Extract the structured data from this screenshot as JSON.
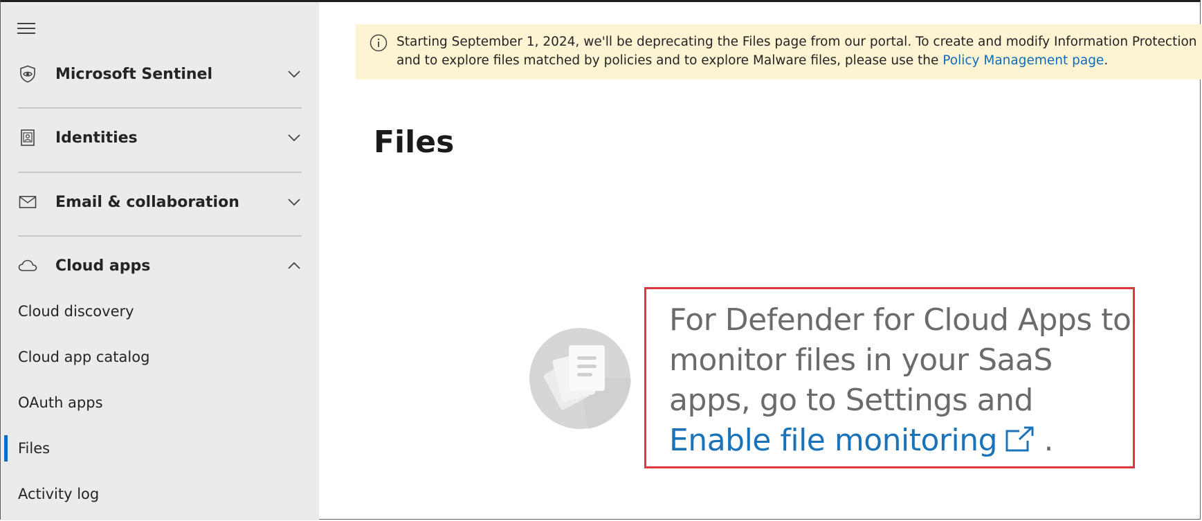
{
  "sidebar": {
    "menu_icon": "hamburger-icon",
    "groups": [
      {
        "label": "Microsoft Sentinel",
        "icon": "shield-eye-icon",
        "expanded": false
      },
      {
        "label": "Identities",
        "icon": "identity-card-icon",
        "expanded": false
      },
      {
        "label": "Email & collaboration",
        "icon": "mail-icon",
        "expanded": false
      },
      {
        "label": "Cloud apps",
        "icon": "cloud-icon",
        "expanded": true
      }
    ],
    "items": [
      {
        "label": "Cloud discovery",
        "active": false
      },
      {
        "label": "Cloud app catalog",
        "active": false
      },
      {
        "label": "OAuth apps",
        "active": false
      },
      {
        "label": "Files",
        "active": true
      },
      {
        "label": "Activity log",
        "active": false
      }
    ]
  },
  "banner": {
    "icon": "info-icon",
    "line1": "Starting September 1, 2024, we'll be deprecating the Files page from our portal. To create and modify Information Protection policies,",
    "line2_prefix": "and to explore files matched by policies and to explore Malware files, please use the ",
    "link": "Policy Management page",
    "line2_suffix": "."
  },
  "page": {
    "title": "Files"
  },
  "empty_state": {
    "illustration": "files-stack-icon",
    "text": "For Defender for Cloud Apps to monitor files in your SaaS apps, go to Settings and ",
    "link": "Enable file monitoring",
    "link_icon": "external-link-icon",
    "suffix": " ."
  },
  "colors": {
    "sidebar_bg": "#ebebeb",
    "banner_bg": "#fcf4d2",
    "accent": "#0f6cbd",
    "highlight": "#e0353d"
  }
}
